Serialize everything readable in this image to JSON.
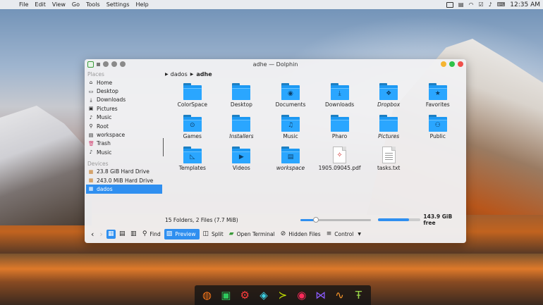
{
  "menubar": {
    "apple_icon": "apple-icon",
    "items": [
      "File",
      "Edit",
      "View",
      "Go",
      "Tools",
      "Settings",
      "Help"
    ],
    "clock": "12:35 AM"
  },
  "window": {
    "title": "adhe — Dolphin"
  },
  "places": {
    "header": "Places",
    "items": [
      {
        "label": "Home",
        "icon": "home-icon",
        "glyph": "⌂"
      },
      {
        "label": "Desktop",
        "icon": "desktop-icon",
        "glyph": "▭"
      },
      {
        "label": "Downloads",
        "icon": "downloads-icon",
        "glyph": "⤓"
      },
      {
        "label": "Pictures",
        "icon": "pictures-icon",
        "glyph": "▣"
      },
      {
        "label": "Music",
        "icon": "music-icon",
        "glyph": "♪"
      },
      {
        "label": "Root",
        "icon": "root-icon",
        "glyph": "⚲"
      },
      {
        "label": "workspace",
        "icon": "workspace-icon",
        "glyph": "▤"
      },
      {
        "label": "Trash",
        "icon": "trash-icon",
        "glyph": "🗑"
      },
      {
        "label": "Music",
        "icon": "music-icon",
        "glyph": "♪"
      }
    ],
    "devices_header": "Devices",
    "devices": [
      {
        "label": "23.8 GiB Hard Drive",
        "icon": "hard-drive-icon",
        "glyph": "▦"
      },
      {
        "label": "243.0 MiB Hard Drive",
        "icon": "hard-drive-icon",
        "glyph": "▦"
      },
      {
        "label": "dados",
        "icon": "hard-drive-icon",
        "glyph": "▦"
      }
    ]
  },
  "breadcrumb": {
    "parent": "dados",
    "current": "adhe"
  },
  "files": [
    {
      "label": "ColorSpace",
      "kind": "folder",
      "glyph": "",
      "italic": false
    },
    {
      "label": "Desktop",
      "kind": "folder",
      "glyph": "",
      "italic": false
    },
    {
      "label": "Documents",
      "kind": "folder",
      "glyph": "◉",
      "italic": false
    },
    {
      "label": "Downloads",
      "kind": "folder",
      "glyph": "⤓",
      "italic": false
    },
    {
      "label": "Dropbox",
      "kind": "folder",
      "glyph": "❖",
      "italic": true
    },
    {
      "label": "Favorites",
      "kind": "folder",
      "glyph": "★",
      "italic": false
    },
    {
      "label": "Games",
      "kind": "folder",
      "glyph": "⊙",
      "italic": false
    },
    {
      "label": "Installers",
      "kind": "folder",
      "glyph": "",
      "italic": true
    },
    {
      "label": "Music",
      "kind": "folder",
      "glyph": "♫",
      "italic": false
    },
    {
      "label": "Pharo",
      "kind": "folder",
      "glyph": "",
      "italic": false
    },
    {
      "label": "Pictures",
      "kind": "folder",
      "glyph": "",
      "italic": true
    },
    {
      "label": "Public",
      "kind": "folder",
      "glyph": "⚇",
      "italic": false
    },
    {
      "label": "Templates",
      "kind": "folder",
      "glyph": "◺",
      "italic": false
    },
    {
      "label": "Videos",
      "kind": "folder",
      "glyph": "▶",
      "italic": false
    },
    {
      "label": "workspace",
      "kind": "folder",
      "glyph": "▤",
      "italic": true
    },
    {
      "label": "1905.09045.pdf",
      "kind": "pdf",
      "glyph": "✧",
      "italic": false
    },
    {
      "label": "tasks.txt",
      "kind": "txt",
      "glyph": "",
      "italic": false
    }
  ],
  "status": {
    "summary": "15 Folders, 2 Files (7.7 MiB)",
    "zoom_fraction": 0.22,
    "used_fraction": 0.72,
    "free": "143.9 GiB free"
  },
  "toolbar": {
    "find": "Find",
    "preview": "Preview",
    "split": "Split",
    "open_terminal": "Open Terminal",
    "hidden_files": "Hidden Files",
    "control": "Control"
  },
  "dock": [
    {
      "icon": "firefox-icon",
      "glyph": "◍",
      "color": "#ff7a1a"
    },
    {
      "icon": "files-icon",
      "glyph": "▣",
      "color": "#2ec95c"
    },
    {
      "icon": "settings-icon",
      "glyph": "⚙",
      "color": "#ff3d3d"
    },
    {
      "icon": "network-icon",
      "glyph": "◈",
      "color": "#3dd2e6"
    },
    {
      "icon": "terminal-icon",
      "glyph": "≻",
      "color": "#c7e600"
    },
    {
      "icon": "eye-icon",
      "glyph": "◉",
      "color": "#ff2a5a"
    },
    {
      "icon": "code-editor-icon",
      "glyph": "⋈",
      "color": "#8c5cff"
    },
    {
      "icon": "activity-icon",
      "glyph": "∿",
      "color": "#ff9a2a"
    },
    {
      "icon": "text-editor-icon",
      "glyph": "Ŧ",
      "color": "#9ad64a"
    }
  ]
}
